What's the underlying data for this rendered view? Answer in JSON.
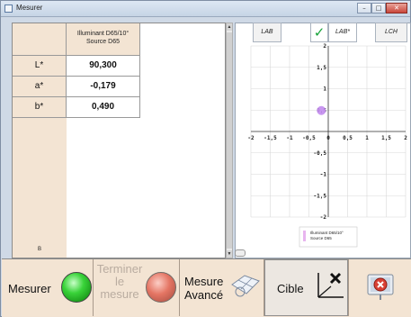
{
  "window": {
    "title": "Mesurer",
    "controls": [
      "minimize",
      "maximize",
      "close"
    ]
  },
  "table": {
    "header": "Illuminant D65/10°\nSource D65",
    "rows": [
      {
        "label": "L*",
        "value": "90,300"
      },
      {
        "label": "a*",
        "value": "-0,179"
      },
      {
        "label": "b*",
        "value": "0,490"
      }
    ],
    "footer_label": "B"
  },
  "chart": {
    "tabs": [
      "LAB",
      "LAB*",
      "LCH"
    ],
    "selected_tab": "LAB*",
    "check_color": "#17a33a",
    "x_ticks": [
      "-2",
      "-1,5",
      "-1",
      "-0,5",
      "0",
      "0,5",
      "1",
      "1,5",
      "2"
    ],
    "y_ticks": [
      "2",
      "1,5",
      "1",
      "0,5",
      "0",
      "-0,5",
      "-1",
      "-1,5",
      "-2"
    ],
    "point": {
      "x": -0.179,
      "y": 0.49,
      "color": "#c38cf0"
    },
    "legend": "Illuminant D65/10°\nSource D65",
    "legend_swatch": "#e8b5ef"
  },
  "buttons": {
    "measure": "Mesurer",
    "finish": "Terminer\nle\nmesure",
    "advanced": "Mesure\nAvancé",
    "target": "Cible"
  }
}
